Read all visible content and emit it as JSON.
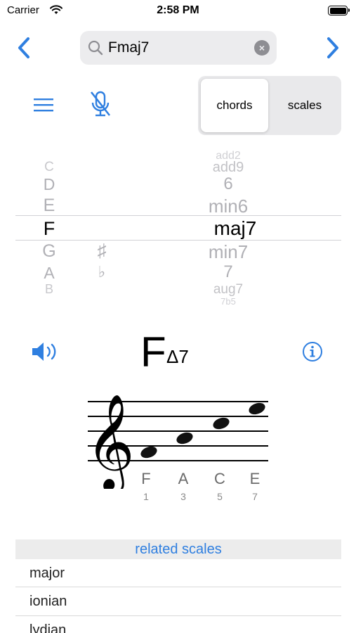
{
  "status_bar": {
    "carrier": "Carrier",
    "time": "2:58 PM"
  },
  "search": {
    "value": "Fmaj7",
    "placeholder": ""
  },
  "segmented_control": {
    "options": [
      "chords",
      "scales"
    ],
    "selected": "chords"
  },
  "picker": {
    "notes": [
      "C",
      "D",
      "E",
      "F",
      "G",
      "A",
      "B"
    ],
    "accidentals": [
      "♯",
      "♭"
    ],
    "qualities": [
      "add2",
      "add9",
      "6",
      "min6",
      "maj7",
      "min7",
      "7",
      "aug7",
      "7b5"
    ],
    "selected_note": "F",
    "selected_quality": "maj7"
  },
  "chord": {
    "root": "F",
    "suffix": "Δ7"
  },
  "notation": {
    "notes": [
      {
        "name": "F",
        "degree": "1"
      },
      {
        "name": "A",
        "degree": "3"
      },
      {
        "name": "C",
        "degree": "5"
      },
      {
        "name": "E",
        "degree": "7"
      }
    ]
  },
  "related_scales": {
    "header": "related scales",
    "items": [
      "major",
      "ionian",
      "lydian"
    ]
  },
  "colors": {
    "accent": "#2f7fe0",
    "picker_dim": "#b0b0b5",
    "segment_bg": "#e9e9eb"
  },
  "icons": [
    "wifi-icon",
    "battery-icon",
    "chevron-left-icon",
    "chevron-right-icon",
    "search-icon",
    "clear-icon",
    "menu-icon",
    "mic-off-icon",
    "speaker-icon",
    "info-icon",
    "treble-clef-icon"
  ]
}
